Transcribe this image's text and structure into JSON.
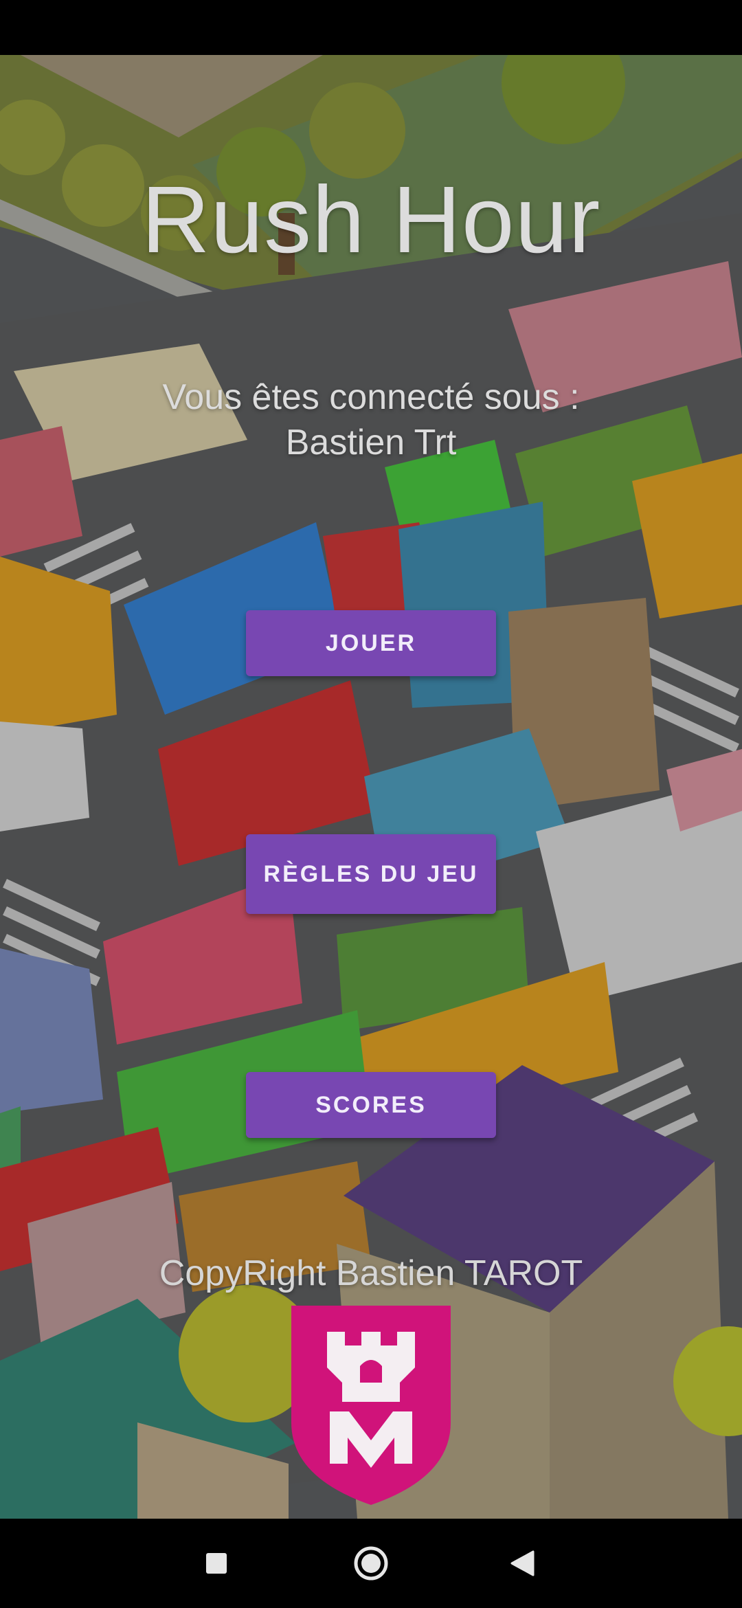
{
  "app": {
    "title": "Rush Hour",
    "login_line1": "Vous êtes connecté sous :",
    "login_line2": "Bastien Trt",
    "copyright": "CopyRight Bastien TAROT"
  },
  "menu": {
    "play_label": "JOUER",
    "rules_label": "RÈGLES DU JEU",
    "scores_label": "SCORES"
  },
  "colors": {
    "button": "#7847b2",
    "button_text": "#f2eefa",
    "logo_badge": "#d0137a",
    "overlay_text": "#dcdcdc"
  },
  "icons": {
    "background": "isometric-traffic-jam-illustration",
    "logo": "tower-m-logo",
    "nav_recents": "square-icon",
    "nav_home": "circle-icon",
    "nav_back": "triangle-back-icon"
  }
}
